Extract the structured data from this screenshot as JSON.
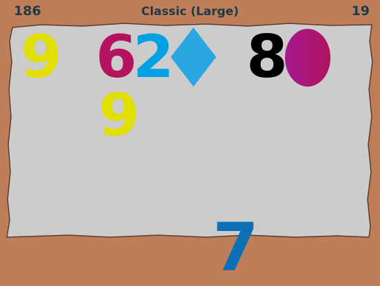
{
  "hud": {
    "score": "186",
    "mode": "Classic (Large)",
    "level": "19"
  },
  "tiles": {
    "nine_a": "9",
    "six": "6",
    "two": "2",
    "eight": "8",
    "nine_b": "9",
    "seven": "7"
  },
  "colors": {
    "frame": "#bf7e5a",
    "board": "#cccccc",
    "yellow": "#e1df00",
    "magenta": "#b5135f",
    "cyan": "#00a1e4",
    "diamond": "#2aa7e3",
    "black": "#000000",
    "oval_left": "#a51a8d",
    "oval_right": "#b0135f",
    "blue": "#0d6fb6",
    "hud_text": "#1e3a46"
  },
  "shapes": {
    "diamond": "diamond-shape",
    "oval": "oval-shape"
  }
}
